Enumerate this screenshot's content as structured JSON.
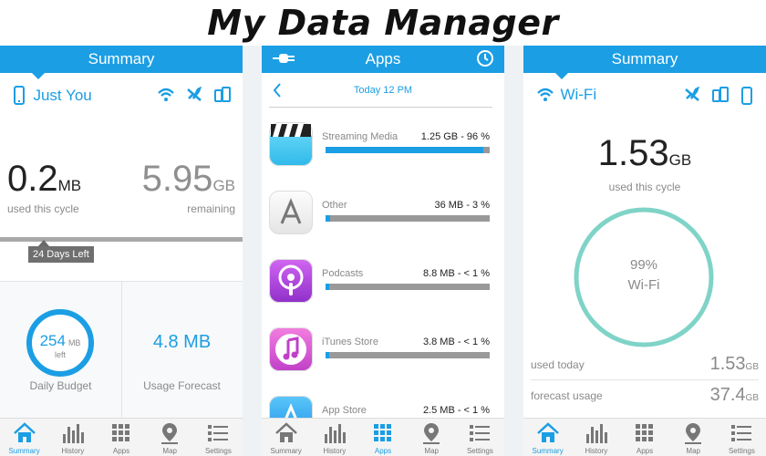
{
  "page_title": "My Data Manager",
  "tabs": [
    "Summary",
    "History",
    "Apps",
    "Map",
    "Settings"
  ],
  "panel1": {
    "header": "Summary",
    "device_label": "Just You",
    "used_value": "0.2",
    "used_unit": "MB",
    "used_label": "used this cycle",
    "remaining_value": "5.95",
    "remaining_unit": "GB",
    "remaining_label": "remaining",
    "days_left": "24 Days Left",
    "budget_value": "254",
    "budget_unit": "MB",
    "budget_sub": "left",
    "budget_label": "Daily Budget",
    "forecast_value": "4.8 MB",
    "forecast_label": "Usage Forecast",
    "active_tab": "Summary"
  },
  "panel2": {
    "header": "Apps",
    "date_label": "Today 12 PM",
    "apps": [
      {
        "name": "Streaming Media",
        "value": "1.25 GB - 96 %",
        "fill": 0.96,
        "icon": "clapperboard-icon"
      },
      {
        "name": "Other",
        "value": "36 MB - 3 %",
        "fill": 0.03,
        "icon": "app-store-a-icon"
      },
      {
        "name": "Podcasts",
        "value": "8.8 MB - < 1 %",
        "fill": 0.01,
        "icon": "podcasts-icon"
      },
      {
        "name": "iTunes Store",
        "value": "3.8 MB - < 1 %",
        "fill": 0.005,
        "icon": "music-note-icon"
      },
      {
        "name": "App Store",
        "value": "2.5 MB - < 1 %",
        "fill": 0.004,
        "icon": "app-store-icon"
      }
    ],
    "active_tab": "Apps"
  },
  "panel3": {
    "header": "Summary",
    "network_label": "Wi-Fi",
    "used_value": "1.53",
    "used_unit": "GB",
    "used_label": "used this cycle",
    "ring_percent": "99%",
    "ring_label": "Wi-Fi",
    "used_today_label": "used today",
    "used_today_value": "1.53",
    "used_today_unit": "GB",
    "forecast_label": "forecast usage",
    "forecast_value": "37.4",
    "forecast_unit": "GB",
    "active_tab": "Summary"
  },
  "colors": {
    "accent": "#1b9ee4",
    "ring": "#7fd3c7",
    "bar_grey": "#999999"
  }
}
